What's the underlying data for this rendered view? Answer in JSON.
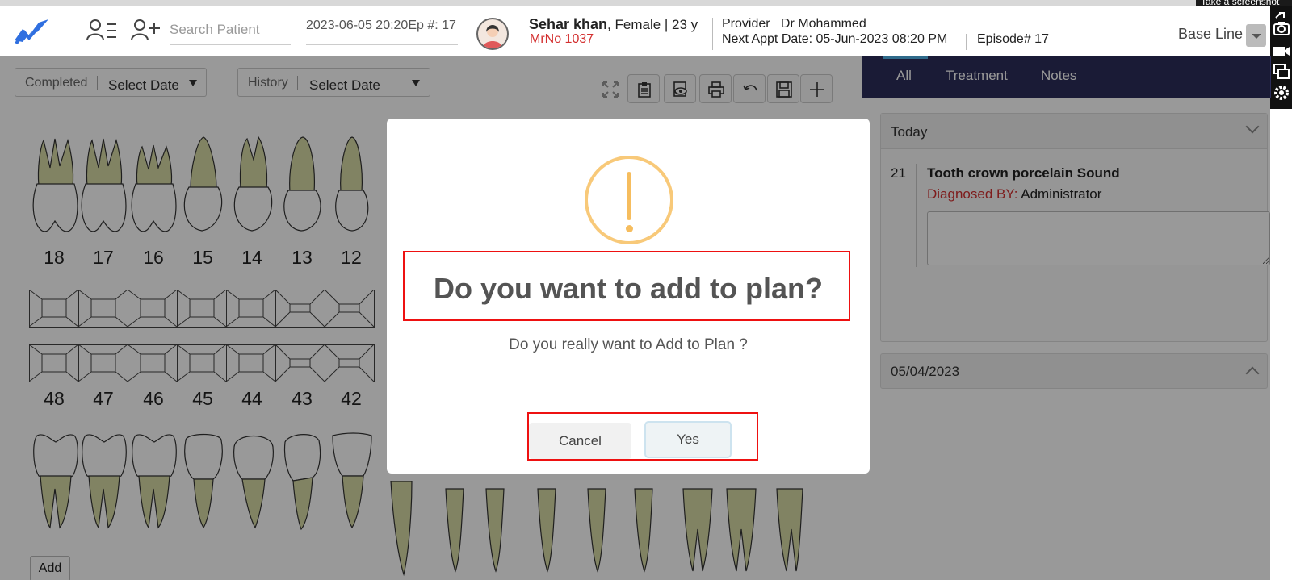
{
  "header": {
    "search_placeholder": "Search Patient",
    "date_episode": "2023-06-05 20:20Ep #: 17",
    "patient_name": "Sehar khan",
    "patient_details": ", Female | 23 y",
    "mrno": "MrNo 1037",
    "provider_label": "Provider",
    "provider_name": "Dr Mohammed",
    "next_appt": "Next Appt Date: 05-Jun-2023 08:20 PM",
    "episode": "Episode# 17",
    "view_mode": "Base Line"
  },
  "tooltip": "Take a screenshot",
  "filters": {
    "completed_label": "Completed",
    "completed_value": "Select Date",
    "history_label": "History",
    "history_value": "Select Date"
  },
  "toolbar_icons": [
    "fullscreen-icon",
    "clipboard-icon",
    "preview-icon",
    "print-icon",
    "undo-icon",
    "save-icon",
    "add-icon"
  ],
  "chart": {
    "upper_teeth": [
      "18",
      "17",
      "16",
      "15",
      "14",
      "13",
      "12"
    ],
    "lower_teeth": [
      "48",
      "47",
      "46",
      "45",
      "44",
      "43",
      "42"
    ],
    "add_label": "Add"
  },
  "right_panel": {
    "tabs": [
      "All",
      "Treatment",
      "Notes"
    ],
    "today_label": "Today",
    "entry": {
      "tooth": "21",
      "title": "Tooth crown porcelain Sound",
      "dx_label": "Diagnosed BY:",
      "dx_value": "Administrator"
    },
    "past_label": "05/04/2023"
  },
  "modal": {
    "title": "Do you want to add to plan?",
    "message": "Do you really want to Add to Plan ?",
    "cancel_label": "Cancel",
    "yes_label": "Yes"
  },
  "colors": {
    "tab_bar": "#2c2d5a",
    "tooth_fill": "#d8dba6",
    "warning": "#f8c979",
    "highlight": "#e11111",
    "mrno": "#d32f2f"
  }
}
